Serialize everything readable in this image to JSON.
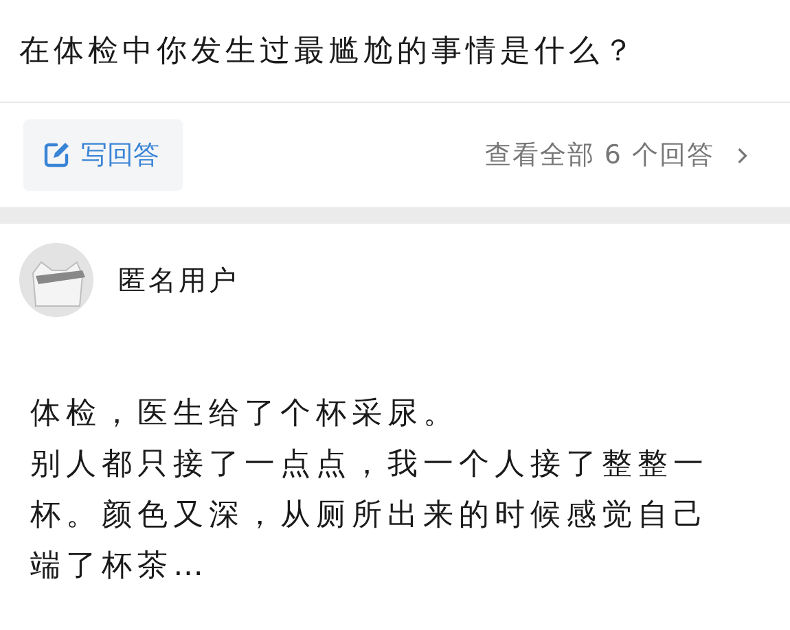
{
  "question": {
    "title": "在体检中你发生过最尴尬的事情是什么？"
  },
  "actions": {
    "write_answer": "写回答",
    "view_all": "查看全部 6 个回答"
  },
  "answer": {
    "author": "匿名用户",
    "paragraphs": [
      "体检，医生给了个杯采尿。",
      "别人都只接了一点点，我一个人接了整整一杯。颜色又深，从厕所出来的时候感觉自己端了杯茶…"
    ]
  }
}
